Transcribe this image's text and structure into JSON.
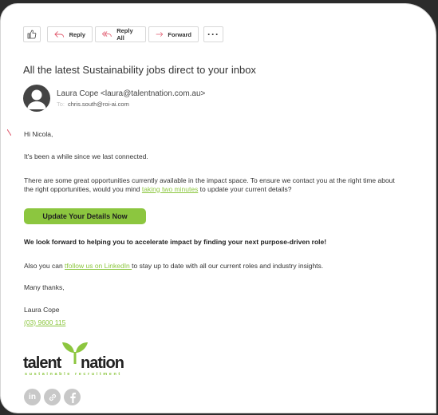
{
  "toolbar": {
    "reply_label": "Reply",
    "reply_all_label": "Reply All",
    "forward_label": "Forward",
    "more_label": "···"
  },
  "email": {
    "subject": "All the latest Sustainability jobs direct to your inbox",
    "from": "Laura Cope <laura@talentnation.com.au>",
    "to_label": "To:",
    "to": "chris.south@roi-ai.com",
    "greeting": "Hi Nicola,",
    "p1": "It's been a while since we last connected.",
    "p2_before": "There are some great opportunities currently available in the impact space. To ensure we contact you at the right time about the right opportunities, would you mind ",
    "p2_link": "taking two minutes",
    "p2_after": " to update your current details?",
    "cta_label": "Update Your Details Now",
    "p3": "We look forward to helping you to accelerate impact by finding your next purpose-driven role!",
    "p4_before": "Also you can ",
    "p4_link": "tfollow us on LinkedIn ",
    "p4_after": "to stay up to date with all our current roles and industry insights.",
    "signoff": "Many thanks,",
    "sig_name": "Laura Cope",
    "sig_phone": "(03) 9600 115"
  },
  "logo": {
    "word1": "talent",
    "word2": "nation",
    "tagline": "sustainable recruitment"
  },
  "social": {
    "linkedin": "in"
  },
  "colors": {
    "accent": "#8cc63f",
    "reply_icon": "#e05a6e"
  }
}
